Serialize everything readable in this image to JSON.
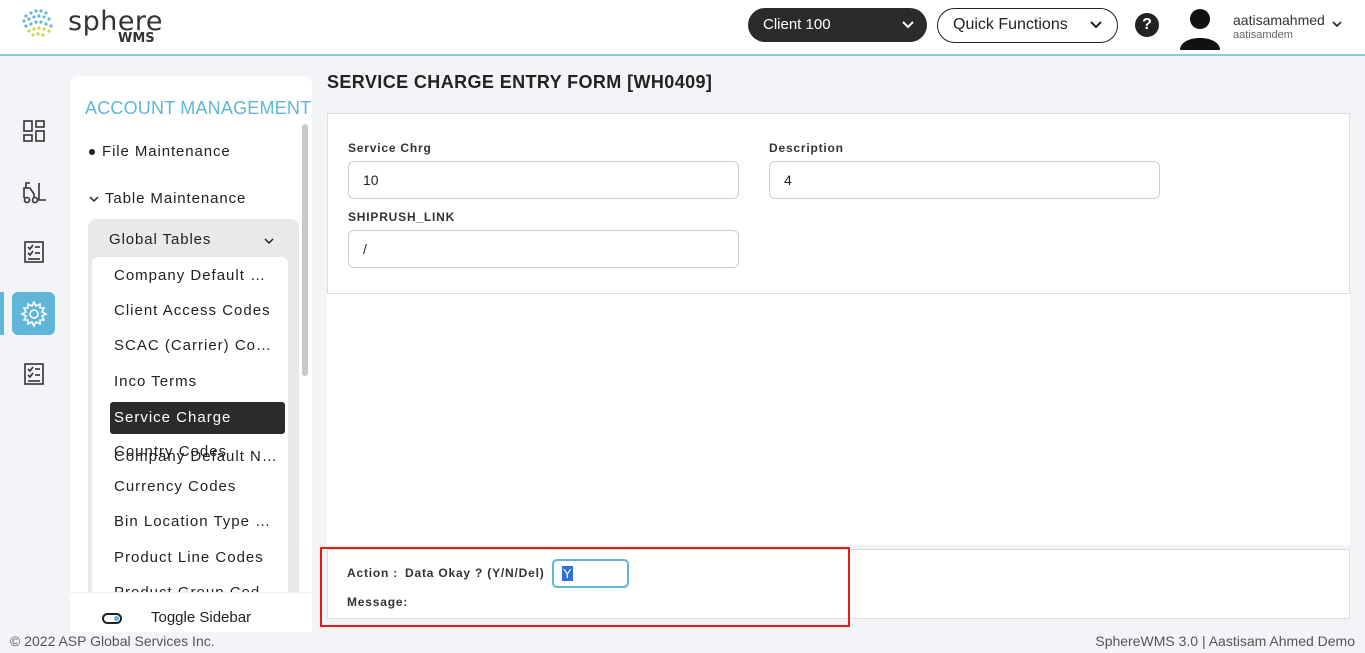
{
  "header": {
    "logo_text": "sphere",
    "logo_sub": "WMS",
    "client_selector": "Client 100",
    "quick_functions": "Quick Functions",
    "help_label": "?",
    "user_name": "aatisamahmed",
    "user_id": "aatisamdem"
  },
  "sidebar": {
    "title": "ACCOUNT MANAGEMENT",
    "file_maintenance": "File Maintenance",
    "table_maintenance": "Table Maintenance",
    "global_tables": "Global Tables",
    "items": [
      {
        "label": "Company Default Names"
      },
      {
        "label": "Client Access Codes"
      },
      {
        "label": "SCAC (Carrier) Codes"
      },
      {
        "label": "Inco Terms"
      },
      {
        "label": "Service Charge"
      },
      {
        "label": "Country Codes"
      },
      {
        "label": "Currency Codes"
      },
      {
        "label": "Bin Location Type Codes"
      },
      {
        "label": "Product Line Codes"
      },
      {
        "label": "Product Group Codes"
      }
    ],
    "toggle_label": "Toggle Sidebar"
  },
  "main": {
    "title": "SERVICE CHARGE ENTRY FORM [WH0409]",
    "fields": {
      "service_chrg_label": "Service Chrg",
      "service_chrg_value": "10",
      "description_label": "Description",
      "description_value": "4",
      "shiprush_label": "SHIPRUSH_LINK",
      "shiprush_value": "/"
    },
    "action": {
      "label": "Action :",
      "prompt": "Data Okay ? (Y/N/Del)",
      "value": "Y",
      "message_label": "Message:"
    }
  },
  "footer": {
    "copyright": "© 2022 ASP Global Services Inc.",
    "version": "SphereWMS 3.0 | Aastisam Ahmed Demo"
  },
  "colors": {
    "accent": "#5fb6d8",
    "dark": "#2b2b2b",
    "highlight": "#e21b1b"
  }
}
